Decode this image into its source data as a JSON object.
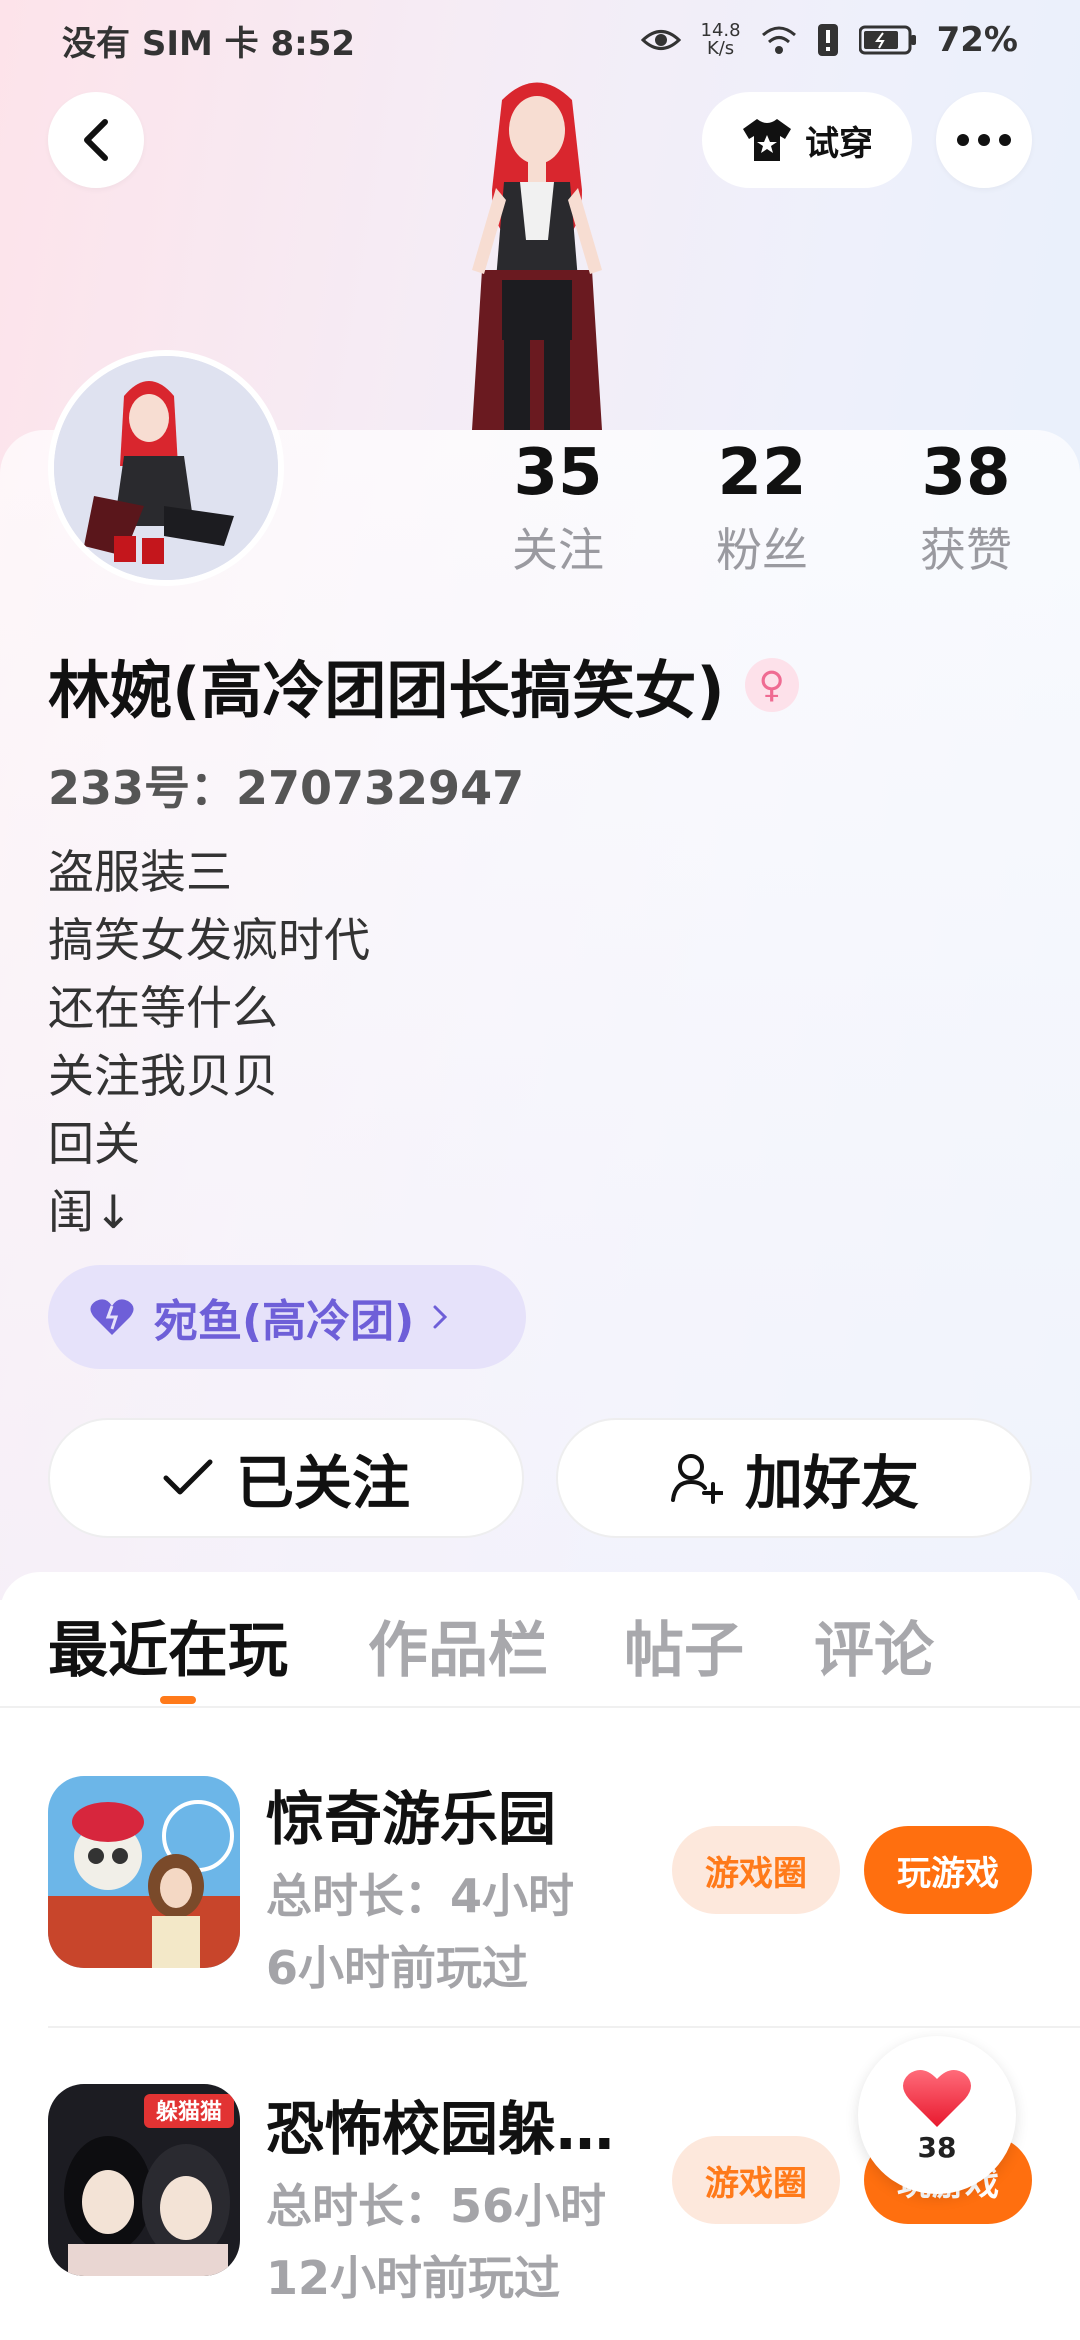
{
  "status_bar": {
    "carrier_time": "没有 SIM 卡 8:52",
    "speed_value": "14.8",
    "speed_unit": "K/s",
    "battery": "72%"
  },
  "header": {
    "try_on_label": "试穿"
  },
  "profile": {
    "stats": [
      {
        "value": "35",
        "label": "关注"
      },
      {
        "value": "22",
        "label": "粉丝"
      },
      {
        "value": "38",
        "label": "获赞"
      }
    ],
    "nickname": "林婉(高冷团团长搞笑女)",
    "uid": "233号：270732947",
    "bio": [
      "盗服装三",
      "搞笑女发疯时代",
      "还在等什么",
      "关注我贝贝",
      "回关",
      "闺↓"
    ],
    "club_label": "宛鱼(高冷团)",
    "following_label": "已关注",
    "add_friend_label": "加好友"
  },
  "tabs": [
    "最近在玩",
    "作品栏",
    "帖子",
    "评论"
  ],
  "games": [
    {
      "title": "惊奇游乐园",
      "duration": "总时长：4小时",
      "last_played": "6小时前玩过",
      "circle_label": "游戏圈",
      "play_label": "玩游戏"
    },
    {
      "title": "恐怖校园躲…",
      "duration": "总时长：56小时",
      "last_played": "12小时前玩过",
      "circle_label": "游戏圈",
      "play_label": "玩游戏",
      "icon_text": "躲猫猫"
    }
  ],
  "like_float": {
    "count": "38"
  },
  "colors": {
    "accent": "#ff6f0f",
    "club": "#6e5fd8",
    "gender": "#ef6b92"
  }
}
